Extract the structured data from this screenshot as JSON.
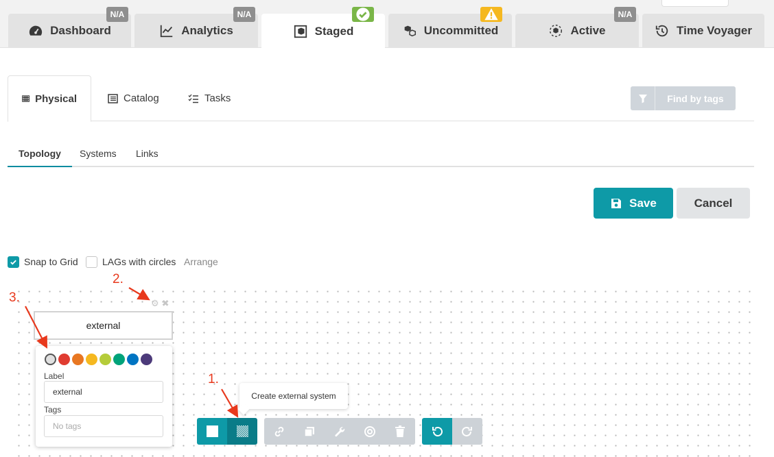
{
  "top_tabs": [
    {
      "label": "Dashboard",
      "icon": "dashboard-icon",
      "badge": "N/A"
    },
    {
      "label": "Analytics",
      "icon": "analytics-icon",
      "badge": "N/A"
    },
    {
      "label": "Staged",
      "icon": "staged-icon",
      "badge": "ok",
      "active": true
    },
    {
      "label": "Uncommitted",
      "icon": "uncommitted-icon",
      "badge": "warning"
    },
    {
      "label": "Active",
      "icon": "active-icon",
      "badge": "N/A"
    },
    {
      "label": "Time Voyager",
      "icon": "history-icon",
      "badge": ""
    }
  ],
  "secondary_tabs": [
    {
      "label": "Physical",
      "icon": "server-icon",
      "active": true
    },
    {
      "label": "Catalog",
      "icon": "catalog-icon"
    },
    {
      "label": "Tasks",
      "icon": "tasks-icon"
    }
  ],
  "find_by_tags": {
    "label": "Find by tags",
    "icon": "filter-icon"
  },
  "sub_tabs": [
    {
      "label": "Topology",
      "active": true
    },
    {
      "label": "Systems"
    },
    {
      "label": "Links"
    }
  ],
  "actions": {
    "save_label": "Save",
    "cancel_label": "Cancel"
  },
  "options": {
    "snap_to_grid": {
      "label": "Snap to Grid",
      "checked": true
    },
    "lags_with_circles": {
      "label": "LAGs with circles",
      "checked": false
    },
    "arrange_label": "Arrange"
  },
  "node": {
    "label": "external"
  },
  "properties": {
    "colors": [
      "#e0e0e0",
      "#e03c31",
      "#e87722",
      "#f5b820",
      "#b5cc3a",
      "#00a37a",
      "#0074c2",
      "#4c3a7a"
    ],
    "selected_color_index": 0,
    "label_title": "Label",
    "label_value": "external",
    "tags_title": "Tags",
    "tags_placeholder": "No tags"
  },
  "tooltip": {
    "text": "Create external system"
  },
  "annotations": {
    "one": "1.",
    "two": "2.",
    "three": "3."
  },
  "colors": {
    "accent": "#0e9aa7",
    "accent_dark": "#0a7c88",
    "annotation": "#e8391d",
    "disabled": "#cdd2d7"
  }
}
